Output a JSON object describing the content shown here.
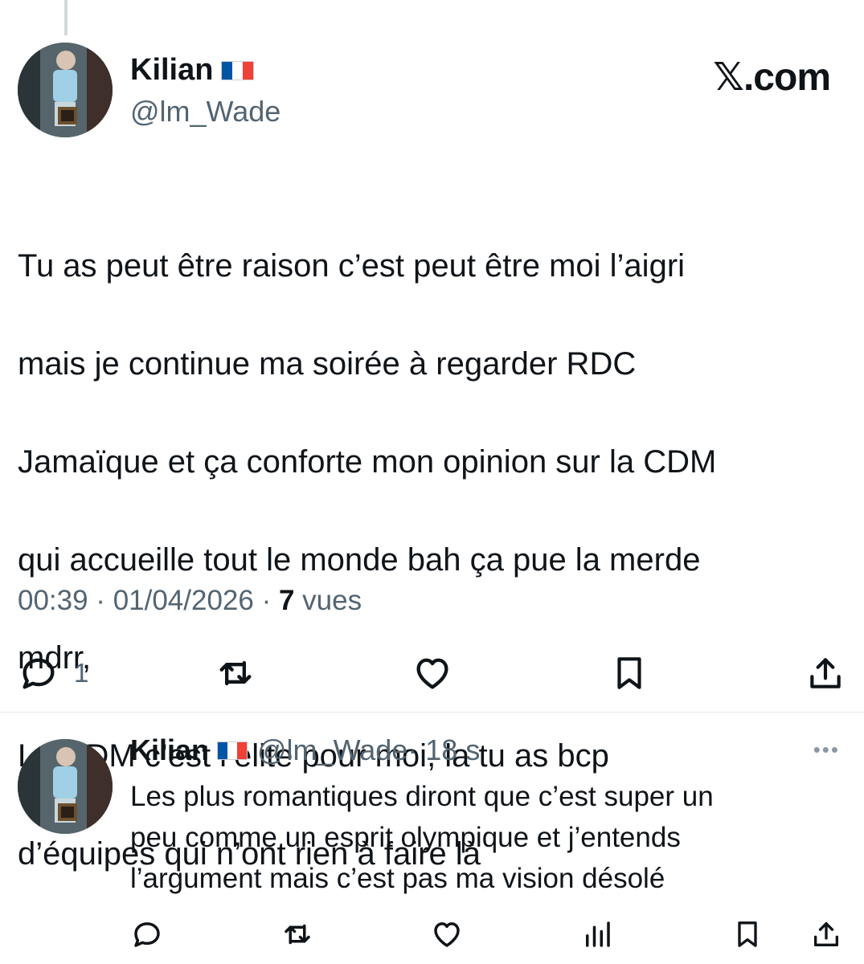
{
  "main_tweet": {
    "author_name": "Kilian",
    "author_handle": "@lm_Wade",
    "brand": "𝕏.com",
    "lines": [
      "Tu as peut être raison c’est peut être moi l’aigri",
      "mais je continue ma soirée à regarder RDC",
      "Jamaïque et ça conforte mon opinion sur la CDM",
      "qui accueille tout le monde bah ça pue la merde",
      "mdrr,",
      "La CDM c’est l’élite pour moi, la tu as bcp",
      "d’équipes qui n’ont rien à faire là"
    ],
    "time": "00:39 · 01/04/2026 · ",
    "views_count": "7",
    "views_label": " vues",
    "reply_count": "1"
  },
  "reply_tweet": {
    "author_name": "Kilian",
    "author_handle": "@lm_Wade",
    "age": " · 18 s",
    "more": "•••",
    "text": "Les plus romantiques diront que c’est super un\npeu comme un esprit olympique et j’entends\nl’argument mais c’est pas ma vision désolé"
  },
  "colors": {
    "text": "#0f1419",
    "secondary": "#536471",
    "flag_blue": "#0055a4",
    "flag_white": "#ffffff",
    "flag_red": "#ef4135"
  },
  "icons": {
    "reply": "speech-bubble-icon",
    "retweet": "retweet-icon",
    "like": "heart-icon",
    "views": "bar-chart-icon",
    "bookmark": "bookmark-icon",
    "share": "share-icon"
  }
}
